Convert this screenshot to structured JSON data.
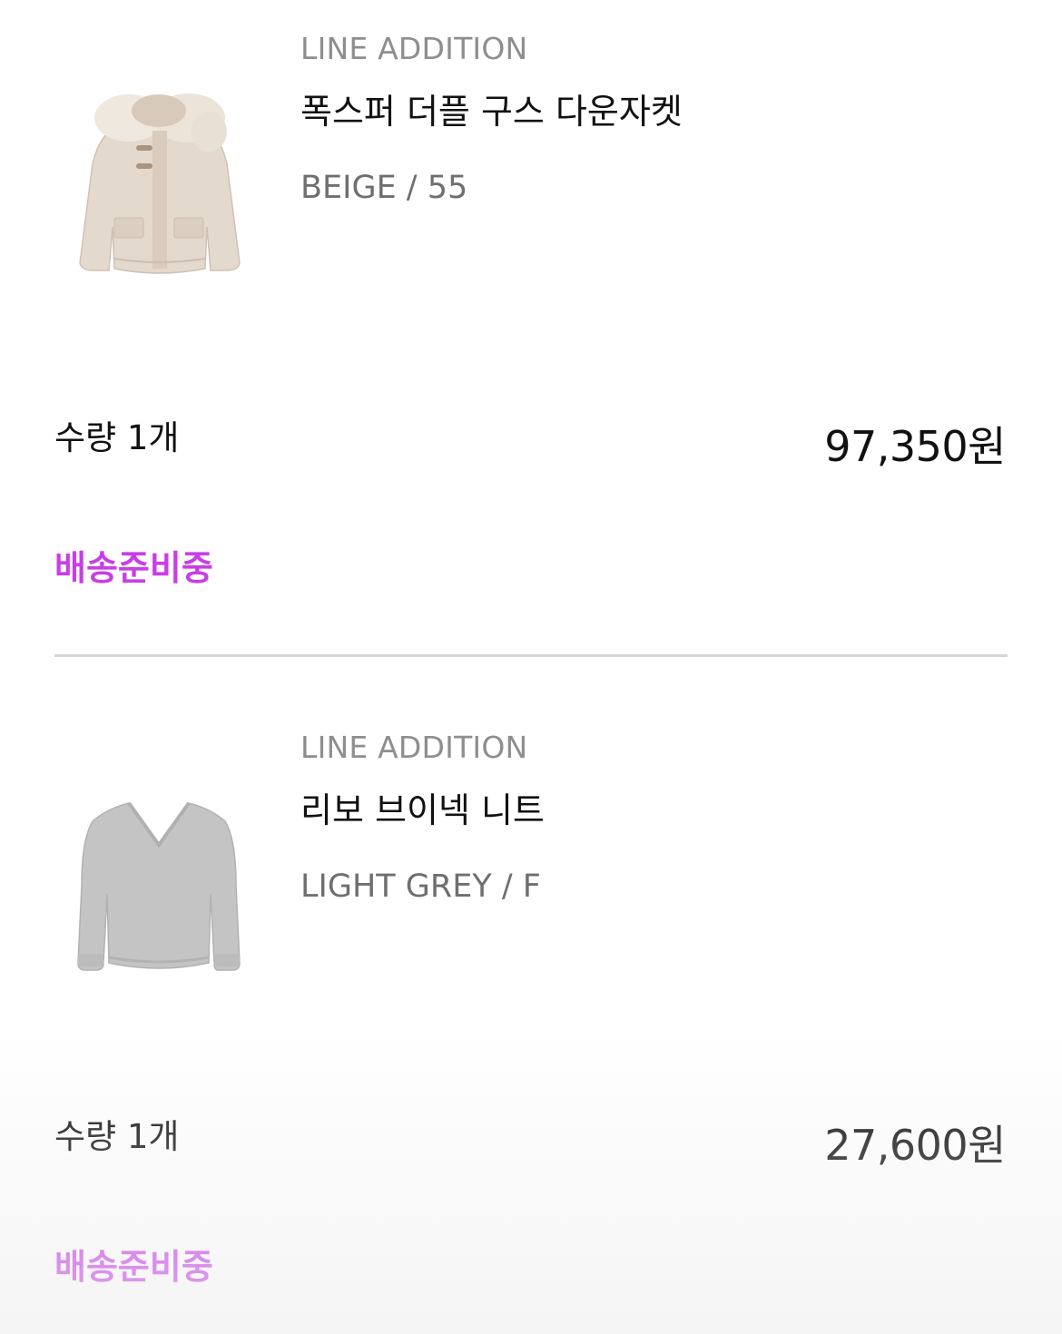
{
  "orders": [
    {
      "brand": "LINE ADDITION",
      "product_name": "폭스퍼 더플 구스 다운자켓",
      "option": "BEIGE / 55",
      "quantity": "수량 1개",
      "price": "97,350원",
      "status": "배송준비중",
      "image_icon": "down-jacket-image"
    },
    {
      "brand": "LINE ADDITION",
      "product_name": "리보 브이넥 니트",
      "option": "LIGHT GREY / F",
      "quantity": "수량 1개",
      "price": "27,600원",
      "status": "배송준비중",
      "image_icon": "knit-sweater-image"
    }
  ],
  "colors": {
    "status": "#c83ee6",
    "brand": "#8e8e8e",
    "option": "#6f6f6f",
    "divider": "#d6d6d6",
    "jacket": "#e3d8cc",
    "sweater": "#c2c2c2"
  }
}
